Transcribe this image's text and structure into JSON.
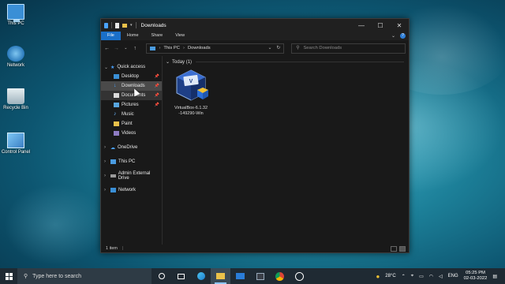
{
  "desktop": {
    "icons": [
      {
        "label": "This PC"
      },
      {
        "label": "Network"
      },
      {
        "label": "Recycle Bin"
      },
      {
        "label": "Control Panel"
      }
    ]
  },
  "window": {
    "title": "Downloads",
    "ribbon_tabs": [
      "File",
      "Home",
      "Share",
      "View"
    ],
    "address": {
      "root": "This PC",
      "folder": "Downloads"
    },
    "search_placeholder": "Search Downloads",
    "nav": {
      "quick_access": "Quick access",
      "pinned": [
        "Desktop",
        "Downloads",
        "Documents",
        "Pictures"
      ],
      "unpinned": [
        "Music",
        "Paint",
        "Videos"
      ],
      "roots": [
        "OneDrive",
        "This PC",
        "Admin External Drive",
        "Network"
      ]
    },
    "group_header": "Today (1)",
    "file": {
      "name_line1": "VirtualBox-6.1.32",
      "name_line2": "-149290-Win"
    },
    "status": "1 item"
  },
  "taskbar": {
    "search_placeholder": "Type here to search",
    "weather": "28°C",
    "language": "ENG",
    "time": "05:25 PM",
    "date": "02-03-2022"
  },
  "colors": {
    "accent": "#1a6fc9",
    "window_bg": "#191919",
    "taskbar_bg": "#1f2a33"
  }
}
